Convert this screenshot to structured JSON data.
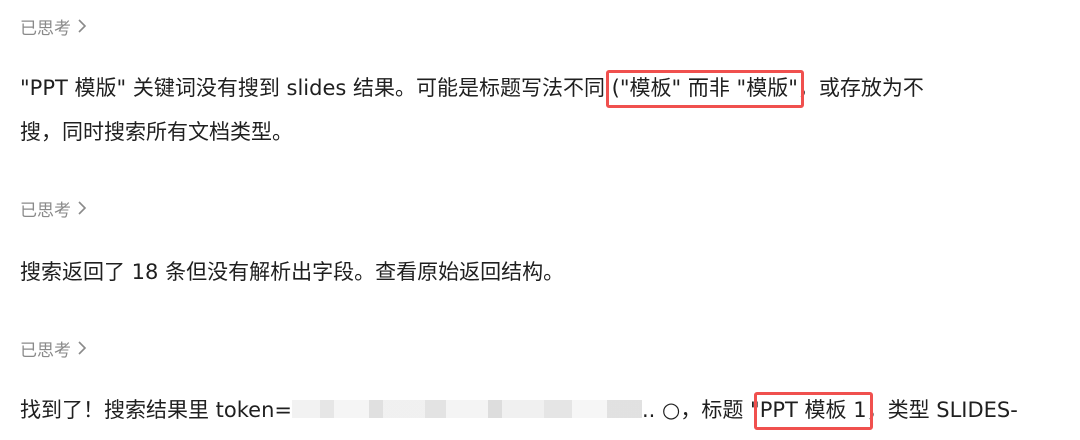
{
  "thinking": {
    "label": "已思考",
    "icon": "chevron-right-icon"
  },
  "message1": {
    "part1": "\"PPT 模版\" 关键词没有搜到 slides 结果。可能是标题写法不同",
    "highlight": "(\"模板\" 而非 \"模版\"",
    "part2": "，或存放为不",
    "line2": "搜，同时搜索所有文档类型。"
  },
  "message2": {
    "text": "搜索返回了 18 条但没有解析出字段。查看原始返回结构。"
  },
  "message3": {
    "part1": "找到了！搜索结果里 token=",
    "redacted_tail": ".. ○",
    "part2": "，标题 \"",
    "highlight": "PPT 模板 1",
    "part3": "，类型 SLIDES-"
  },
  "colors": {
    "highlight_border": "#f0504e",
    "muted_text": "#8a8a8a",
    "body_text": "#1f1f1f"
  }
}
